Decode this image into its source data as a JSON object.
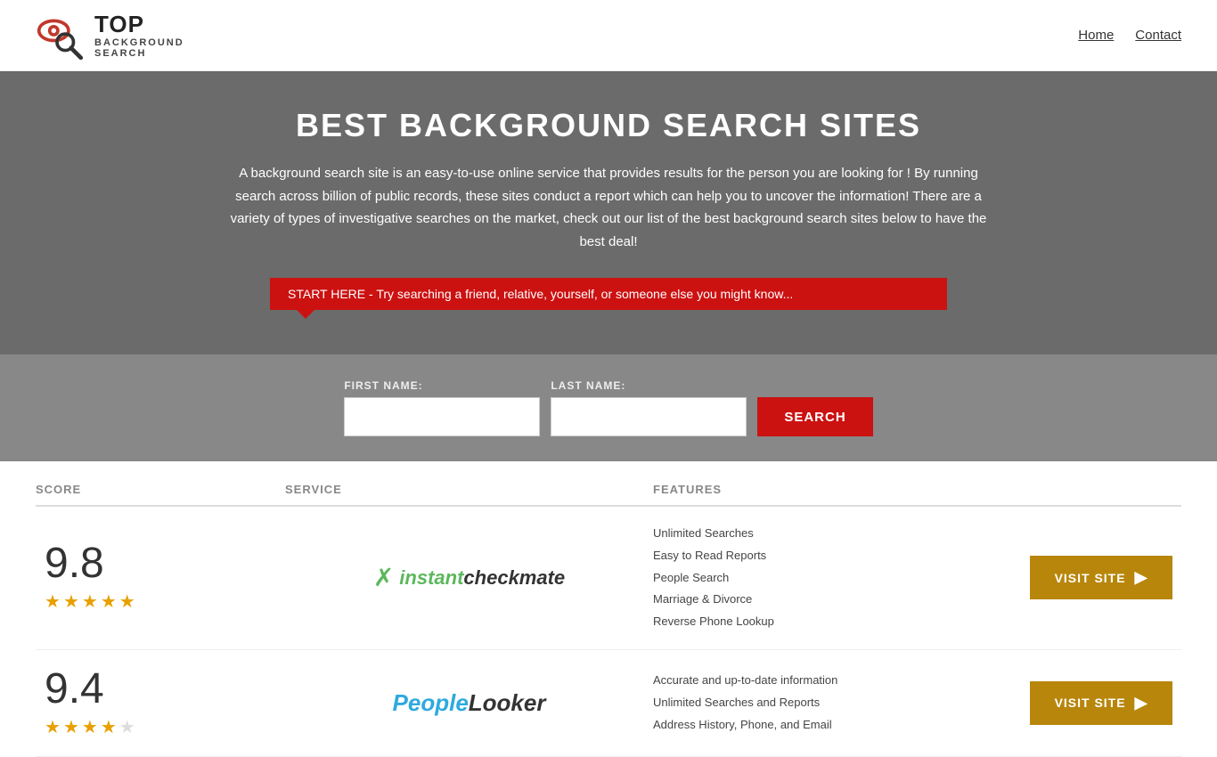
{
  "header": {
    "logo_top": "TOP",
    "logo_bottom": "BACKGROUND\nSEARCH",
    "nav": [
      {
        "label": "Home",
        "href": "#"
      },
      {
        "label": "Contact",
        "href": "#"
      }
    ]
  },
  "hero": {
    "title": "BEST BACKGROUND SEARCH SITES",
    "description": "A background search site is an easy-to-use online service that provides results  for the person you are looking for ! By  running  search across billion of public records, these sites conduct  a report which can help you to uncover the information! There are a variety of types of investigative searches on the market, check out our  list of the best background search sites below to have the best deal!",
    "callout": "START HERE - Try searching a friend, relative, yourself, or someone else you might know..."
  },
  "search": {
    "first_name_label": "FIRST NAME:",
    "last_name_label": "LAST NAME:",
    "button_label": "SEARCH",
    "first_name_placeholder": "",
    "last_name_placeholder": ""
  },
  "table": {
    "headers": [
      "SCORE",
      "SERVICE",
      "FEATURES",
      ""
    ],
    "rows": [
      {
        "score": "9.8",
        "stars": 4.5,
        "service_name": "InstantCheckmate",
        "features": [
          "Unlimited Searches",
          "Easy to Read Reports",
          "People Search",
          "Marriage & Divorce",
          "Reverse Phone Lookup"
        ],
        "visit_label": "VISIT SITE"
      },
      {
        "score": "9.4",
        "stars": 4.0,
        "service_name": "PeopleLooker",
        "features": [
          "Accurate and up-to-date information",
          "Unlimited Searches and Reports",
          "Address History, Phone, and Email"
        ],
        "visit_label": "VISIT SITE"
      }
    ]
  }
}
